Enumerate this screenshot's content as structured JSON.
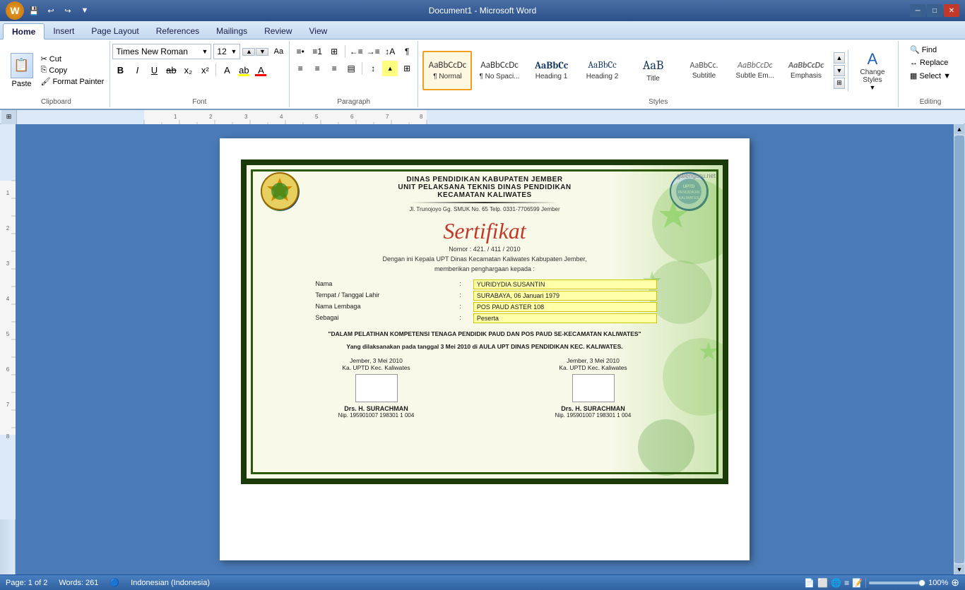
{
  "titlebar": {
    "title": "Document1 - Microsoft Word",
    "minimize": "─",
    "maximize": "□",
    "close": "✕"
  },
  "ribbon": {
    "tabs": [
      "Home",
      "Insert",
      "Page Layout",
      "References",
      "Mailings",
      "Review",
      "View"
    ],
    "active_tab": "Home",
    "groups": {
      "clipboard": {
        "label": "Clipboard",
        "paste_label": "Paste",
        "copy_label": "Copy",
        "format_painter_label": "Format Painter",
        "cut_label": "Cut"
      },
      "font": {
        "label": "Font",
        "font_name": "Times New Roman",
        "font_size": "12",
        "bold": "B",
        "italic": "I",
        "underline": "U",
        "strikethrough": "ab",
        "subscript": "x₂",
        "superscript": "x²",
        "highlight": "A",
        "font_color": "A"
      },
      "paragraph": {
        "label": "Paragraph"
      },
      "styles": {
        "label": "Styles",
        "items": [
          {
            "id": "normal",
            "preview": "AaBbCcDc",
            "label": "¶ Normal",
            "active": true
          },
          {
            "id": "no-spacing",
            "preview": "AaBbCcDc",
            "label": "¶ No Spaci..."
          },
          {
            "id": "heading1",
            "preview": "AaBbCc",
            "label": "Heading 1"
          },
          {
            "id": "heading2",
            "preview": "AaBbCc",
            "label": "Heading 2"
          },
          {
            "id": "title",
            "preview": "AaB",
            "label": "Title"
          },
          {
            "id": "subtitle",
            "preview": "AaBbCc.",
            "label": "Subtitle"
          },
          {
            "id": "subtle-em",
            "preview": "AaBbCcDc",
            "label": "Subtle Em..."
          },
          {
            "id": "emphasis",
            "preview": "AaBbCcDc",
            "label": "Emphasis"
          }
        ]
      },
      "change_styles": {
        "label": "Change\nStyles"
      },
      "editing": {
        "label": "Editing",
        "find_label": "Find",
        "replace_label": "Replace",
        "select_label": "Select ▼"
      }
    }
  },
  "statusbar": {
    "page": "Page: 1 of 2",
    "words": "Words: 261",
    "language": "Indonesian (Indonesia)",
    "zoom": "100%"
  },
  "certificate": {
    "org_line1": "DINAS PENDIDIKAN KABUPATEN JEMBER",
    "org_line2": "UNIT PELAKSANA TEKNIS DINAS PENDIDIKAN",
    "org_line3": "KECAMATAN KALIWATES",
    "address": "Jl. Trunojoyo Gg. SMUK No. 65 Telp. 0331-7706599 Jember",
    "title": "Sertifikat",
    "number": "Nomor : 421. / 411 / 2010",
    "intro": "Dengan ini Kepala UPT Dinas Kecamatan Kaliwates Kabupaten Jember,",
    "intro2": "memberikan penghargaan kepada :",
    "field_name_label": "Nama",
    "field_name_value": "YURIDYDIA SUSANTIN",
    "field_birth_label": "Tempat / Tanggal Lahir",
    "field_birth_value": "SURABAYA, 06 Januari 1979",
    "field_inst_label": "Nama Lembaga",
    "field_inst_value": "POS PAUD ASTER 108",
    "field_role_label": "Sebagai",
    "field_role_value": "Peserta",
    "statement": "\"DALAM PELATIHAN KOMPETENSI TENAGA PENDIDIK PAUD DAN POS PAUD SE-KECAMATAN KALIWATES\"",
    "statement2": "Yang dilaksanakan pada tanggal 3 Mei 2010 di AULA UPT DINAS PENDIDIKAN KEC. KALIWATES.",
    "sig_left_place": "Jember, 3 Mei 2010",
    "sig_left_role": "Ka. UPTD Kec. Kaliwates",
    "sig_left_name": "Drs. H. SURACHMAN",
    "sig_left_nip": "Nip. 195901007 198301 1 004",
    "sig_right_place": "Jember, 3 Mei 2010",
    "sig_right_role": "Ka. UPTD Kec. Kaliwates",
    "sig_right_name": "Drs. H. SURACHMAN",
    "sig_right_nip": "Nip. 195901007 198301 1 004",
    "watermark": "galeriguru.net"
  }
}
